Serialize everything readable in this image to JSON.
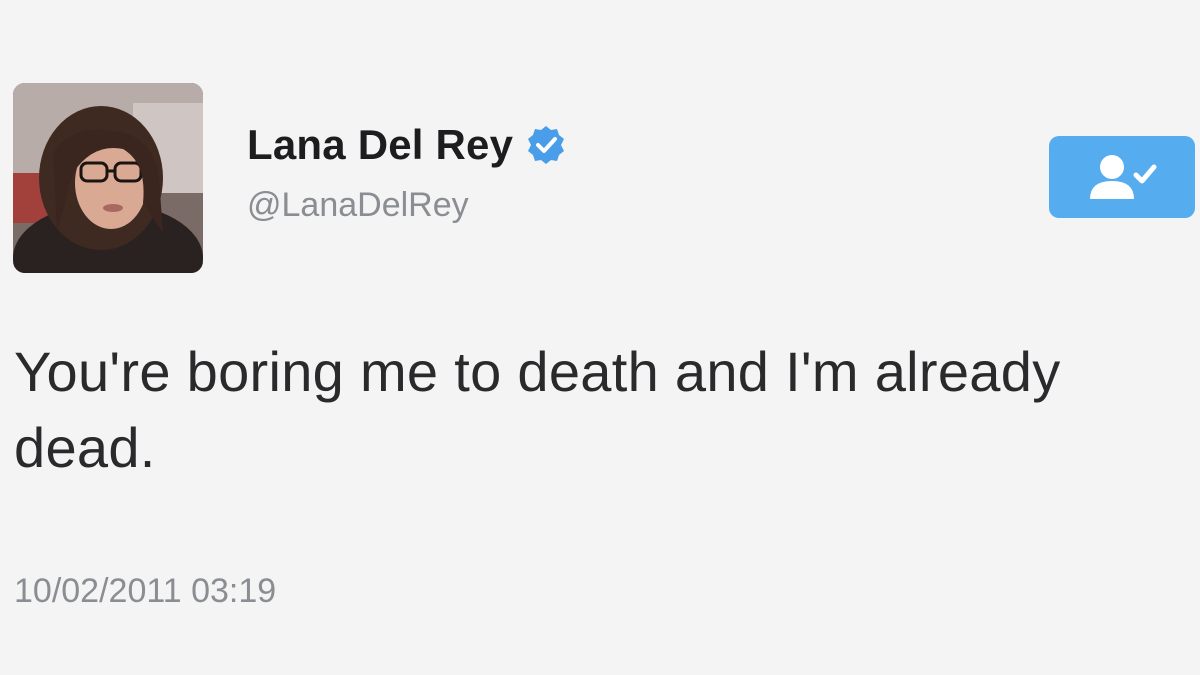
{
  "author": {
    "display_name": "Lana Del Rey",
    "handle": "@LanaDelRey",
    "verified": true,
    "avatar_icon": "profile-photo"
  },
  "follow_button": {
    "icon": "user-following-icon",
    "color": "#55acee"
  },
  "tweet": {
    "text": "You're boring me to death and I'm already dead.",
    "timestamp": "10/02/2011 03:19"
  },
  "colors": {
    "verified_badge": "#4a9de8",
    "handle_text": "#8a8d91",
    "name_text": "#1d1d1f"
  }
}
